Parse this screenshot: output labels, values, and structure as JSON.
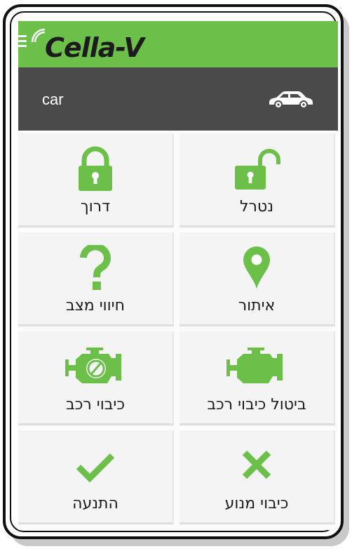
{
  "app": {
    "logo_text": "Cella-V"
  },
  "icons": {
    "menu": "menu-icon",
    "signal": "signal-icon",
    "car": "car-icon"
  },
  "colors": {
    "accent": "#6cc04a",
    "appbar": "#6cc04a",
    "vehicle_bar": "#4a4a4a",
    "tile_bg": "#f4f4f4",
    "icon_green": "#6cc04a"
  },
  "vehicle": {
    "name": "car"
  },
  "tiles": [
    {
      "id": "lock",
      "label": "דרוך",
      "icon": "lock-icon"
    },
    {
      "id": "unlock",
      "label": "נטרל",
      "icon": "unlock-icon"
    },
    {
      "id": "status",
      "label": "חיווי מצב",
      "icon": "question-icon"
    },
    {
      "id": "locate",
      "label": "איתור",
      "icon": "location-pin-icon"
    },
    {
      "id": "immobilize",
      "label": "כיבוי רכב",
      "icon": "engine-off-icon"
    },
    {
      "id": "cancel-immobilize",
      "label": "ביטול כיבוי רכב",
      "icon": "engine-icon"
    },
    {
      "id": "start",
      "label": "התנעה",
      "icon": "check-icon"
    },
    {
      "id": "engine-stop",
      "label": "כיבוי מנוע",
      "icon": "close-icon"
    }
  ]
}
